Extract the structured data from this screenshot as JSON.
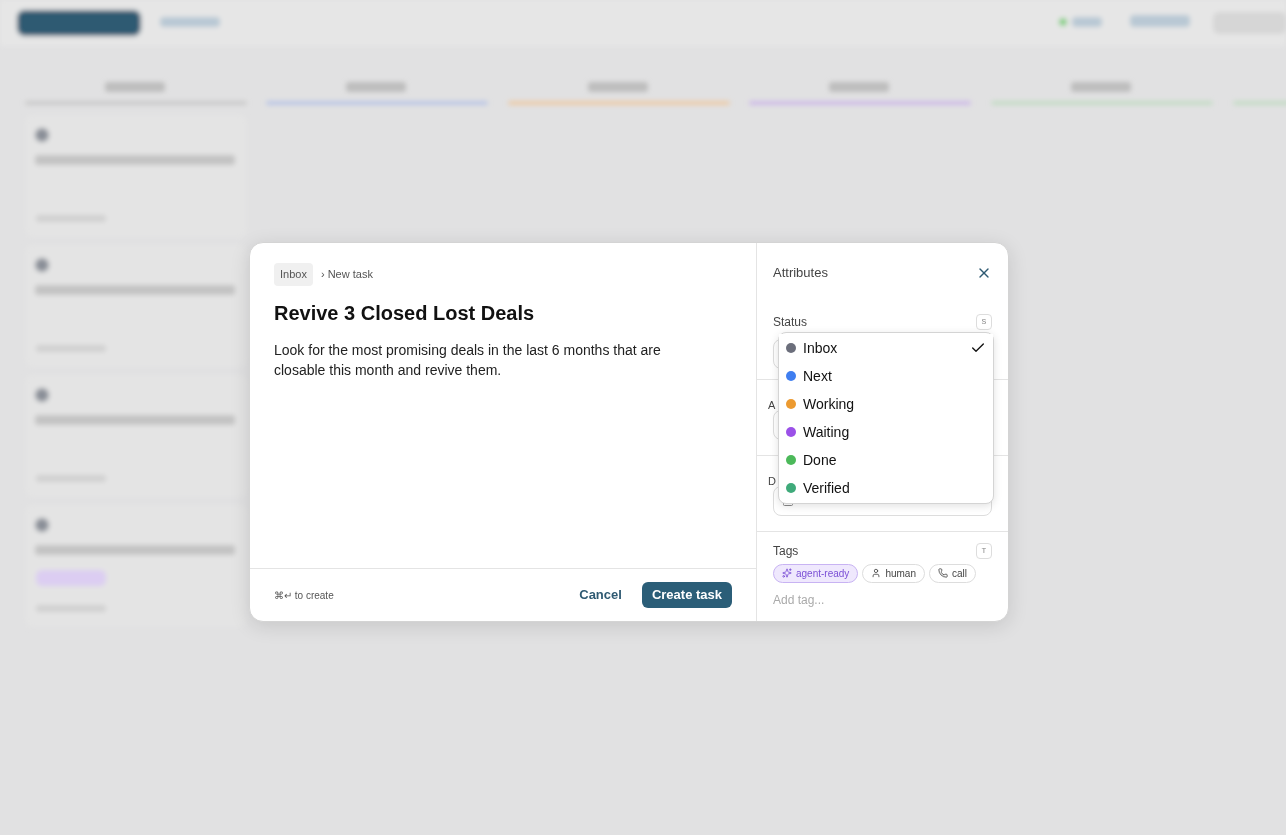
{
  "dialog": {
    "breadcrumb": {
      "parent": "Inbox",
      "current": "› New task"
    },
    "title": "Revive 3 Closed Lost Deals",
    "description": "Look for the most promising deals in the last 6 months that are closable this month and revive them.",
    "shortcut_hint": "⌘↵ to create",
    "cancel": "Cancel",
    "submit": "Create task"
  },
  "attributes": {
    "title": "Attributes",
    "status": {
      "label": "Status",
      "key": "S"
    },
    "covered_fields": [
      {
        "label": "A"
      },
      {
        "label": "D",
        "has_checkbox": true
      }
    ],
    "tags": {
      "label": "Tags",
      "key": "T",
      "placeholder": "Add tag...",
      "items": [
        {
          "label": "agent-ready",
          "kind": "sparkle",
          "selected": true
        },
        {
          "label": "human",
          "kind": "person",
          "selected": false
        },
        {
          "label": "call",
          "kind": "phone",
          "selected": false
        }
      ]
    }
  },
  "status_menu": [
    {
      "label": "Inbox",
      "color": "#6b6e7b",
      "selected": true
    },
    {
      "label": "Next",
      "color": "#3f7ef0",
      "selected": false
    },
    {
      "label": "Working",
      "color": "#ec9a30",
      "selected": false
    },
    {
      "label": "Waiting",
      "color": "#9b51e8",
      "selected": false
    },
    {
      "label": "Done",
      "color": "#4cb95a",
      "selected": false
    },
    {
      "label": "Verified",
      "color": "#3faa7a",
      "selected": false
    }
  ]
}
